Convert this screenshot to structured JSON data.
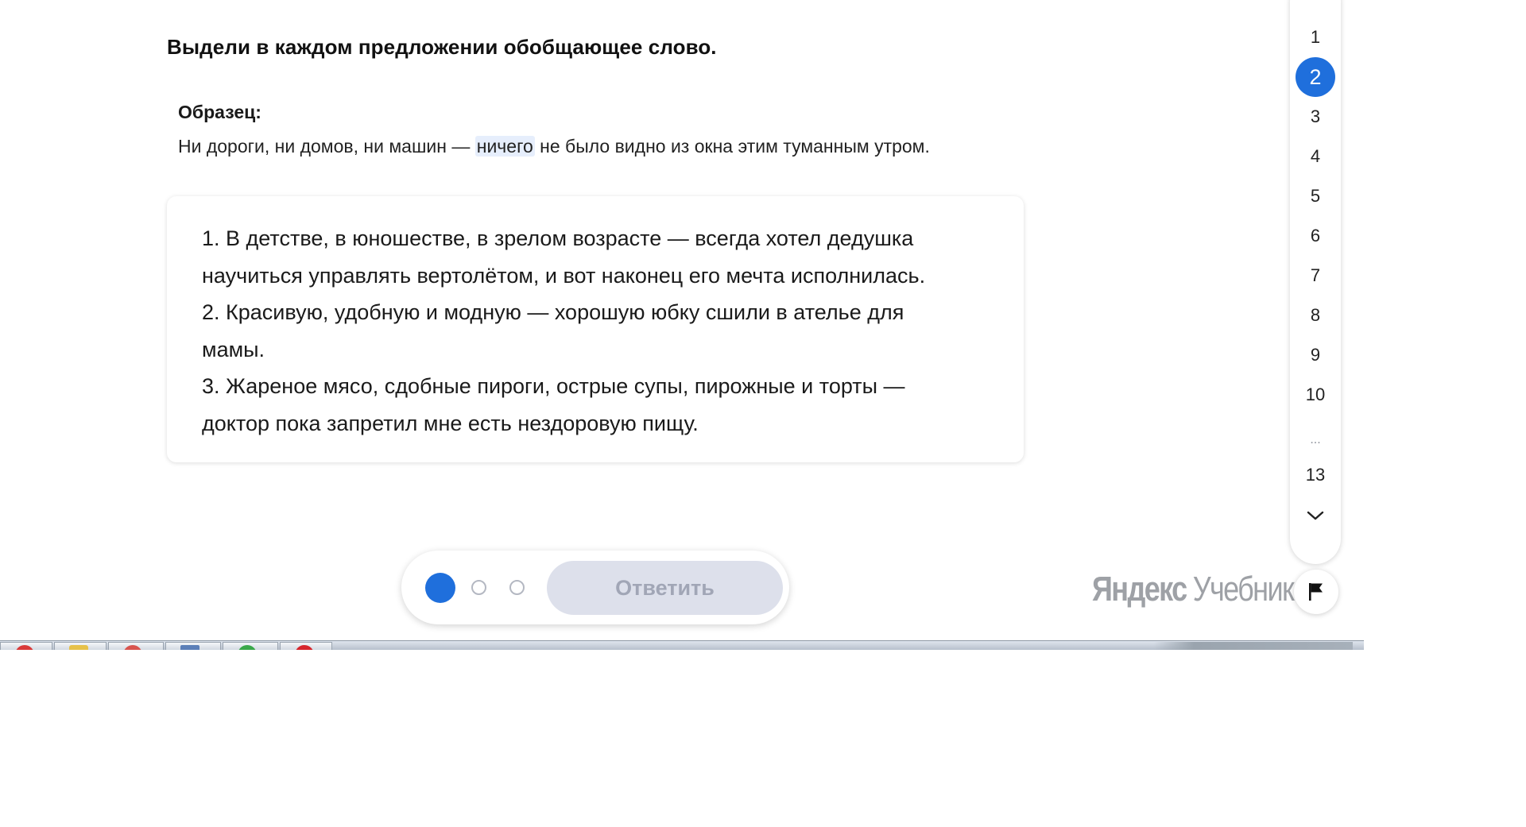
{
  "task": {
    "title": "Выдели в каждом предложении обобщающее слово.",
    "sample_label": "Образец:",
    "sample_before": "Ни дороги, ни домов, ни машин —",
    "sample_highlight": "ничего",
    "sample_after": "не было видно из окна этим туманным утром.",
    "sentences": [
      "1. В детстве, в юношестве, в зрелом возрасте — всегда хотел дедушка",
      "научиться управлять вертолётом, и вот наконец его мечта исполнилась.",
      "2. Красивую, удобную и модную — хорошую юбку сшили в ателье для",
      "мамы.",
      "3. Жареное мясо, сдобные пироги, острые супы, пирожные и торты —",
      "доктор пока запретил мне есть нездоровую пищу."
    ]
  },
  "answer_bar": {
    "button_label": "Ответить",
    "attempts_total": 3,
    "attempts_current": 1
  },
  "brand": {
    "part1": "Яндекс",
    "part2": "Учебник"
  },
  "navigator": {
    "items": [
      "1",
      "2",
      "3",
      "4",
      "5",
      "6",
      "7",
      "8",
      "9",
      "10"
    ],
    "active": "2",
    "ellipsis": "...",
    "last": "13"
  },
  "icons": {
    "chevron": "chevron-down-icon",
    "flag": "flag-icon"
  },
  "colors": {
    "accent": "#1f6fdc",
    "button_disabled_bg": "#dde0eb",
    "button_disabled_text": "#a1a6b6",
    "highlight": "#e6eefc"
  }
}
